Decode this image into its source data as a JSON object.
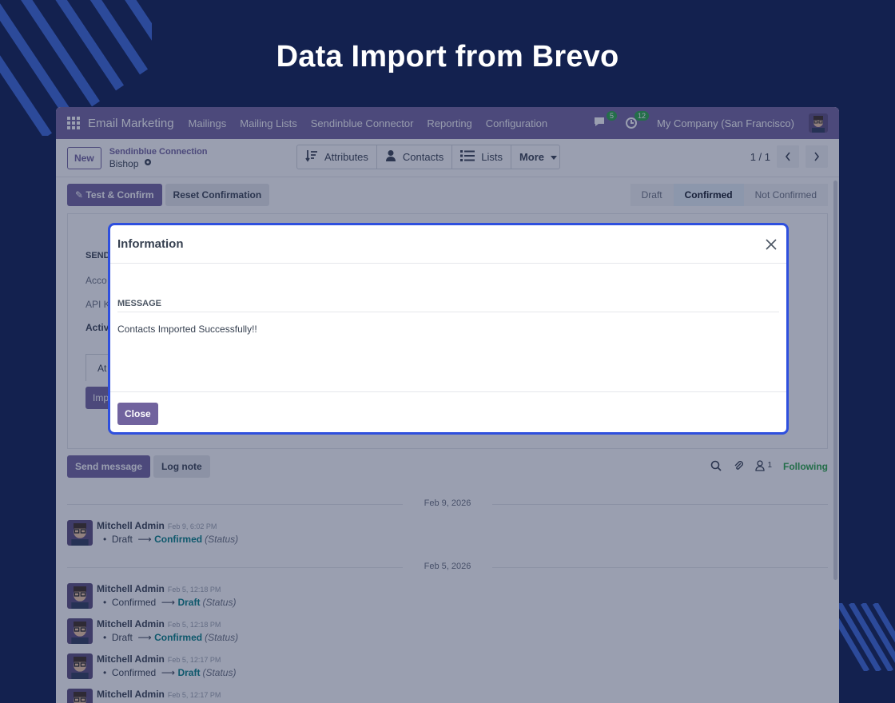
{
  "headline": "Data Import from Brevo",
  "topnav": {
    "app_name": "Email Marketing",
    "menus": [
      "Mailings",
      "Mailing Lists",
      "Sendinblue Connector",
      "Reporting",
      "Configuration"
    ],
    "messages_count": "5",
    "activities_count": "12",
    "company": "My Company (San Francisco)"
  },
  "controlbar": {
    "new_label": "New",
    "breadcrumb": "Sendinblue Connection",
    "record_name": "Bishop",
    "smart_buttons": [
      "Attributes",
      "Contacts",
      "Lists"
    ],
    "more_label": "More",
    "pager": "1 / 1"
  },
  "actions": {
    "test_confirm": "Test & Confirm",
    "reset_confirmation": "Reset Confirmation"
  },
  "statusbar": [
    "Draft",
    "Confirmed",
    "Not Confirmed"
  ],
  "status_active": "Confirmed",
  "sheet": {
    "section": "SEND",
    "field1": "Acco",
    "field2": "API K",
    "field3": "Activ",
    "tab": "At",
    "button": "Imp"
  },
  "chatter": {
    "send_message": "Send message",
    "log_note": "Log note",
    "followers_count": "1",
    "following": "Following",
    "dates": [
      "Feb 9, 2026",
      "Feb 5, 2026"
    ],
    "messages": [
      {
        "author": "Mitchell Admin",
        "time": "Feb 9, 6:02 PM",
        "from": "Draft",
        "to": "Confirmed",
        "field": "(Status)"
      },
      {
        "author": "Mitchell Admin",
        "time": "Feb 5, 12:18 PM",
        "from": "Confirmed",
        "to": "Draft",
        "field": "(Status)"
      },
      {
        "author": "Mitchell Admin",
        "time": "Feb 5, 12:18 PM",
        "from": "Draft",
        "to": "Confirmed",
        "field": "(Status)"
      },
      {
        "author": "Mitchell Admin",
        "time": "Feb 5, 12:17 PM",
        "from": "Confirmed",
        "to": "Draft",
        "field": "(Status)"
      },
      {
        "author": "Mitchell Admin",
        "time": "Feb 5, 12:17 PM",
        "from": "",
        "to": "",
        "field": ""
      }
    ]
  },
  "dialog": {
    "title": "Information",
    "label": "MESSAGE",
    "message": "Contacts Imported Successfully!!",
    "close_label": "Close"
  }
}
